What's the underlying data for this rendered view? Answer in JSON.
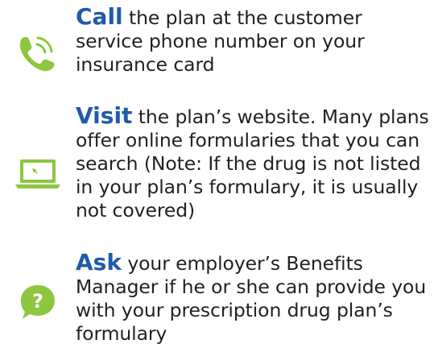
{
  "colors": {
    "keyword": "#1f5ba8",
    "icon": "#8dc63f",
    "body_text": "#231f20"
  },
  "items": [
    {
      "icon": "phone-icon",
      "keyword": "Call",
      "text": " the plan at the customer service phone number on your insurance card"
    },
    {
      "icon": "laptop-icon",
      "keyword": "Visit",
      "text": " the plan’s website. Many plans offer online formularies that you can search (Note: If the drug is not listed in your plan’s formulary, it is usually not covered)"
    },
    {
      "icon": "question-bubble-icon",
      "keyword": "Ask",
      "text": " your employer’s Benefits Manager if he or she can provide you with your prescription drug plan’s formulary"
    }
  ]
}
